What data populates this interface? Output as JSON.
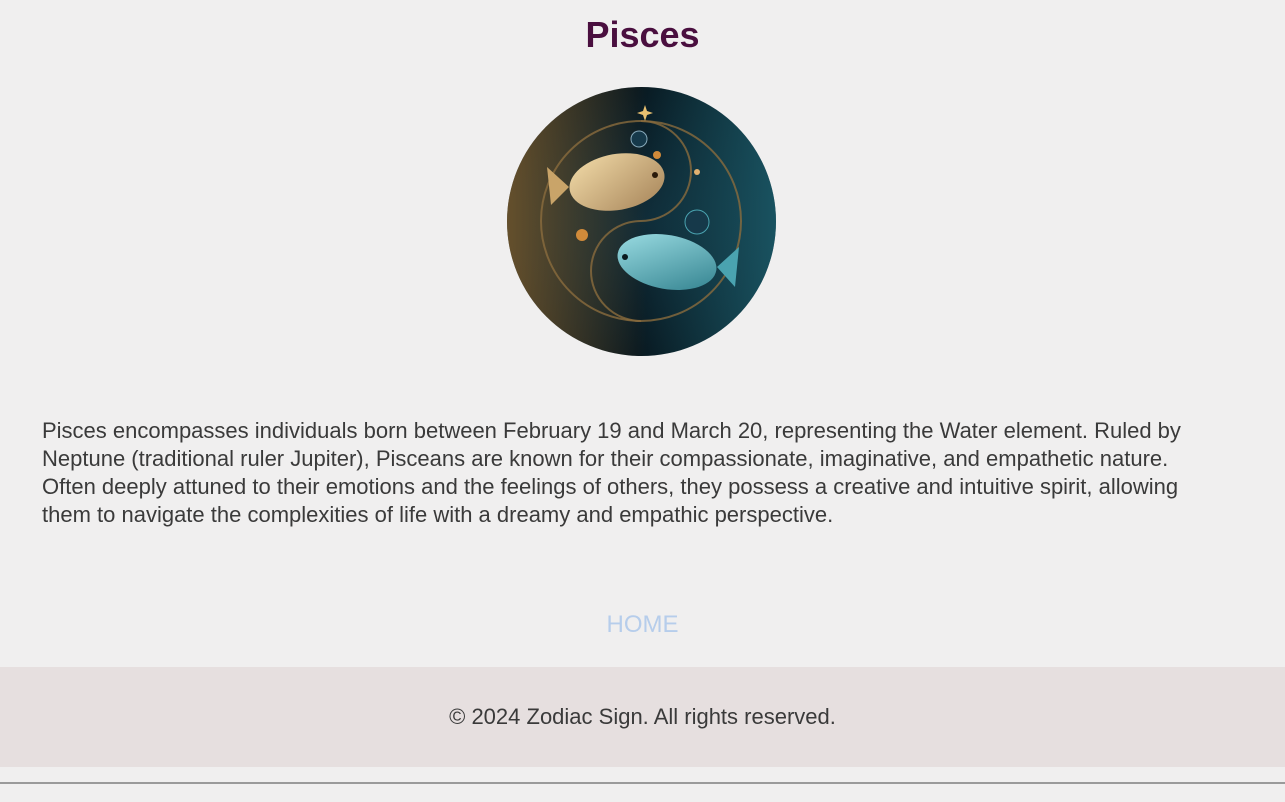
{
  "page": {
    "title": "Pisces",
    "emblem_image": "pisces-two-fish-emblem",
    "description": "Pisces encompasses individuals born between February 19 and March 20, representing the Water element. Ruled by Neptune (traditional ruler Jupiter), Pisceans are known for their compassionate, imaginative, and empathetic nature. Often deeply attuned to their emotions and the feelings of others, they possess a creative and intuitive spirit, allowing them to navigate the complexities of life with a dreamy and empathic perspective.",
    "home_link": "HOME"
  },
  "footer": {
    "copyright": "© 2024 Zodiac Sign. All rights reserved."
  },
  "colors": {
    "background": "#f0efef",
    "title": "#4a0f3f",
    "link": "#b6cdeb",
    "footer_bg": "#e6dfdf"
  }
}
